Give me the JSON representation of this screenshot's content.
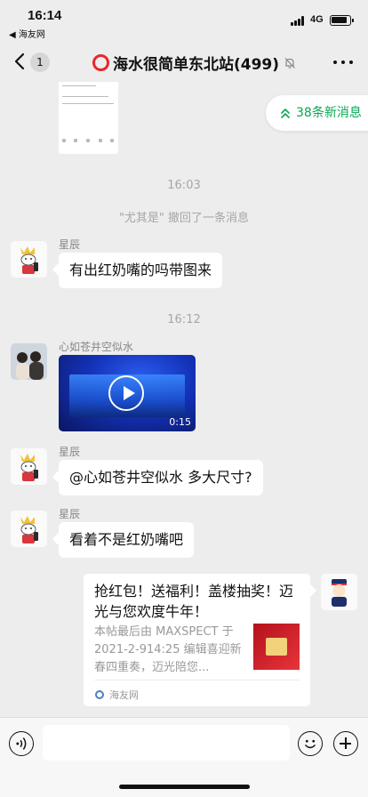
{
  "status_bar": {
    "time": "16:14",
    "back_app": "◀ 海友网",
    "network": "4G"
  },
  "nav": {
    "unread_count": "1",
    "title": "海水很简单东北站(499)"
  },
  "new_messages": {
    "label": "38条新消息"
  },
  "colors": {
    "accent_green": "#07a855",
    "group_ring": "#e8262c",
    "bubble": "#ffffff",
    "background": "#ededed"
  },
  "messages": [
    {
      "type": "timestamp",
      "text": "16:03"
    },
    {
      "type": "system",
      "text": "\"尤其是\" 撤回了一条消息"
    },
    {
      "type": "text",
      "sender": "星辰",
      "text": "有出红奶嘴的吗带图来"
    },
    {
      "type": "timestamp",
      "text": "16:12"
    },
    {
      "type": "video",
      "sender": "心如苍井空似水",
      "duration": "0:15"
    },
    {
      "type": "text",
      "sender": "星辰",
      "text": "@心如苍井空似水 多大尺寸?"
    },
    {
      "type": "text",
      "sender": "星辰",
      "text": "看着不是红奶嘴吧"
    },
    {
      "type": "link_card",
      "title": "抢红包！送福利！盖楼抽奖！迈光与您欢度牛年！",
      "description": "本帖最后由 MAXSPECT 于 2021-2-914:25 编辑喜迎新春四重奏，迈光陪您...",
      "source": "海友网"
    }
  ],
  "input_bar": {
    "placeholder": ""
  }
}
